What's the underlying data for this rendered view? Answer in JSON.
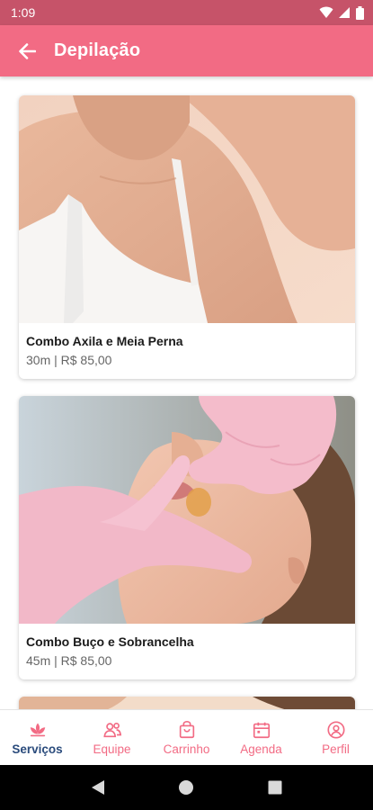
{
  "status_bar": {
    "time": "1:09"
  },
  "app_bar": {
    "title": "Depilação"
  },
  "services": [
    {
      "name": "Combo Axila e Meia Perna",
      "details": "30m | R$ 85,00"
    },
    {
      "name": "Combo Buço e Sobrancelha",
      "details": "45m | R$ 85,00"
    }
  ],
  "bottom_nav": {
    "items": [
      {
        "label": "Serviços",
        "icon": "lotus-icon",
        "active": true
      },
      {
        "label": "Equipe",
        "icon": "team-icon"
      },
      {
        "label": "Carrinho",
        "icon": "shopping-bag-icon"
      },
      {
        "label": "Agenda",
        "icon": "calendar-icon"
      },
      {
        "label": "Perfil",
        "icon": "profile-icon"
      }
    ]
  },
  "colors": {
    "status_bar": "#c65369",
    "app_bar": "#f26b84",
    "nav_active": "#2a4b7c",
    "nav_inactive": "#f26b84"
  }
}
